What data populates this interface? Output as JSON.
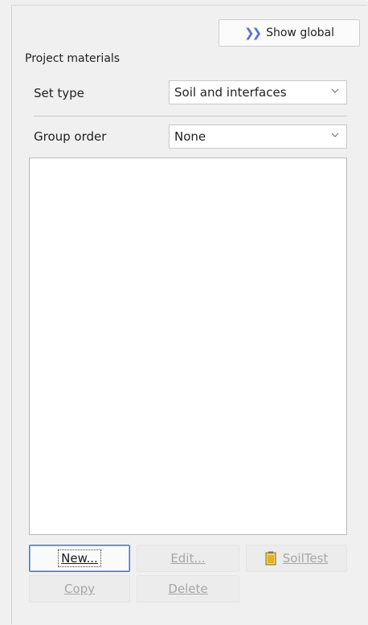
{
  "header": {
    "show_global_label": "Show global",
    "show_global_prefix_icon": "double-chevron-right-icon"
  },
  "group": {
    "title": "Project materials"
  },
  "set_type": {
    "label": "Set type",
    "value": "Soil and interfaces"
  },
  "group_order": {
    "label": "Group order",
    "value": "None"
  },
  "materials_list": {
    "items": []
  },
  "buttons": {
    "new": {
      "label": "New...",
      "enabled": true
    },
    "edit": {
      "label": "Edit...",
      "enabled": false
    },
    "soiltest": {
      "label": "SoilTest",
      "enabled": false,
      "icon": "soiltest-icon"
    },
    "copy": {
      "label": "Copy",
      "enabled": false
    },
    "delete": {
      "label": "Delete",
      "enabled": false
    }
  },
  "colors": {
    "accent": "#5b6fd6",
    "default_button_border": "#3c78c8",
    "disabled_text": "#a6a6a6",
    "soiltest_icon": "#e0b323"
  }
}
